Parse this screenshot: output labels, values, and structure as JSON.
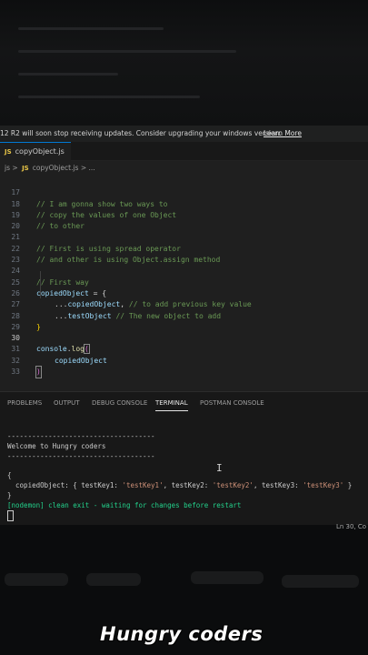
{
  "banner": {
    "message": "12 R2 will soon stop receiving updates. Consider upgrading your windows version.",
    "link": "Learn More"
  },
  "tab": {
    "icon_text": "JS",
    "label": "copyObject.js",
    "icon": "javascript-file-icon"
  },
  "breadcrumb": {
    "root": "js",
    "sep": ">",
    "file": "copyObject.js",
    "rest": "> ..."
  },
  "editor": {
    "line_numbers": [
      "17",
      "18",
      "19",
      "20",
      "21",
      "22",
      "23",
      "24",
      "25",
      "26",
      "27",
      "28",
      "29",
      "30",
      "31",
      "32",
      "33"
    ],
    "lines": {
      "l17": "// I am gonna show two ways to",
      "l18": "// copy the values of one Object",
      "l19": "// to other",
      "l21": "// First is using spread operator",
      "l22": "// and other is using Object.assign method",
      "l24": "// First way",
      "l25_var": "copiedObject",
      "l25_rest": " = {",
      "l26_spread": "...",
      "l26_var": "copiedObject",
      "l26_comma": ", ",
      "l26_comment": "// to add previous key value",
      "l27_spread": "...",
      "l27_var": "testObject",
      "l27_comment": " // The new object to add",
      "l28": "}",
      "l30_obj": "console",
      "l30_dot": ".",
      "l30_fn": "log",
      "l30_paren": "(",
      "l31_var": "copiedObject",
      "l32": ")"
    }
  },
  "panel": {
    "tabs": [
      "PROBLEMS",
      "OUTPUT",
      "DEBUG CONSOLE",
      "TERMINAL",
      "POSTMAN CONSOLE"
    ],
    "active_tab": "TERMINAL"
  },
  "terminal": {
    "separator": "------------------------------------",
    "welcome": "Welcome to Hungry coders",
    "open_brace": "{",
    "obj_prefix": "  copiedObject: { testKey1: ",
    "val1": "'testKey1'",
    "mid1": ", testKey2: ",
    "val2": "'testKey2'",
    "mid2": ", testKey3: ",
    "val3": "'testKey3'",
    "obj_suffix": " }",
    "close_brace": "}",
    "nodemon": "[nodemon] clean exit - waiting for changes before restart"
  },
  "status": {
    "position": "Ln 30, Co"
  },
  "watermark": "Hungry coders"
}
